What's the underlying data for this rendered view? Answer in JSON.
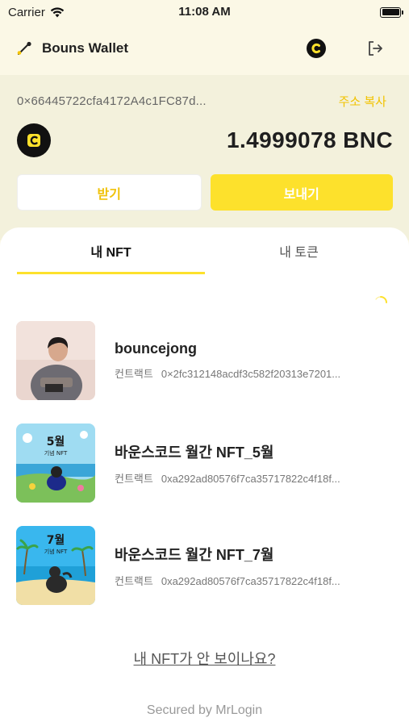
{
  "status_bar": {
    "carrier": "Carrier",
    "time": "11:08 AM"
  },
  "header": {
    "title": "Bouns Wallet"
  },
  "wallet": {
    "address": "0×66445722cfa4172A4c1FC87d...",
    "copy_label": "주소 복사",
    "balance": "1.4999078 BNC",
    "receive_label": "받기",
    "send_label": "보내기"
  },
  "tabs": [
    {
      "label": "내 NFT",
      "active": true
    },
    {
      "label": "내 토큰",
      "active": false
    }
  ],
  "nfts": [
    {
      "name": "bouncejong",
      "contract_label": "컨트랙트",
      "contract": "0×2fc312148acdf3c582f20313e7201..."
    },
    {
      "name": "바운스코드 월간 NFT_5월",
      "contract_label": "컨트랙트",
      "contract": "0xa292ad80576f7ca35717822c4f18f...",
      "thumb_title": "5월",
      "thumb_subtitle": "기념 NFT"
    },
    {
      "name": "바운스코드 월간 NFT_7월",
      "contract_label": "컨트랙트",
      "contract": "0xa292ad80576f7ca35717822c4f18f...",
      "thumb_title": "7월",
      "thumb_subtitle": "기념 NFT"
    }
  ],
  "help_link": "내 NFT가 안 보이나요?",
  "footer": "Secured by MrLogin",
  "colors": {
    "accent": "#fde12c",
    "accent_text": "#f2c300",
    "background": "#fbf8e6"
  }
}
